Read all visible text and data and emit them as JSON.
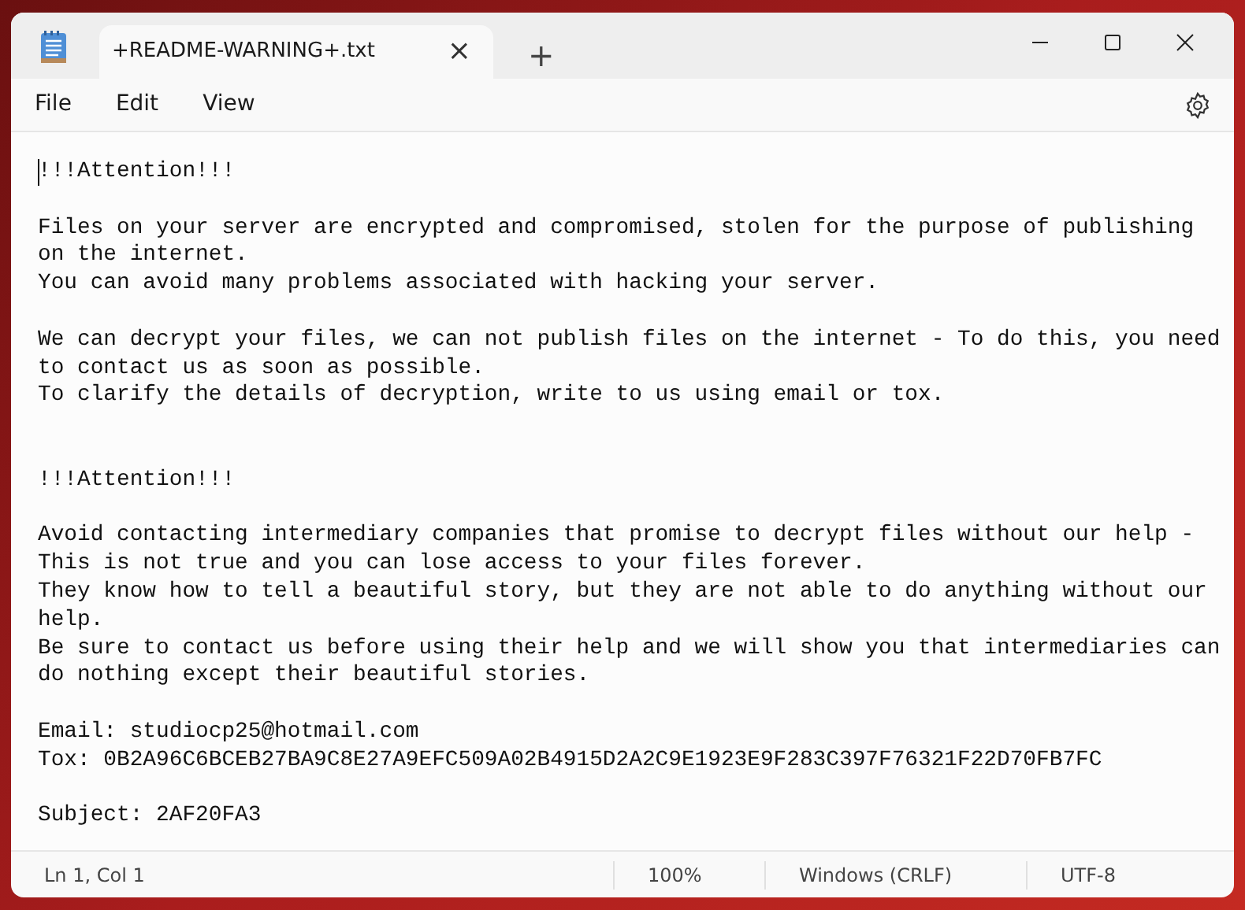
{
  "window": {
    "tabs": [
      {
        "title": "+README-WARNING+.txt",
        "selected": true,
        "close": "×"
      }
    ],
    "new_tab": "+"
  },
  "menu": [
    "File",
    "Edit",
    "View"
  ],
  "document": {
    "cursor_at_start": true,
    "lines": [
      {
        "kind": "text",
        "text": "!!!Attention!!!"
      },
      {
        "kind": "blank"
      },
      {
        "kind": "text",
        "text": "Files on your server are encrypted and compromised, stolen for the purpose of publishing"
      },
      {
        "kind": "text",
        "text": "on the internet."
      },
      {
        "kind": "text",
        "text": "You can avoid many problems associated with hacking your server."
      },
      {
        "kind": "blank"
      },
      {
        "kind": "text",
        "text": "We can decrypt your files, we can not publish files on the internet - To do this, you need"
      },
      {
        "kind": "text",
        "text": "to contact us as soon as possible."
      },
      {
        "kind": "text",
        "text": "To clarify the details of decryption, write to us using email or tox."
      },
      {
        "kind": "blank"
      },
      {
        "kind": "blank"
      },
      {
        "kind": "text",
        "text": "!!!Attention!!!"
      },
      {
        "kind": "blank"
      },
      {
        "kind": "text",
        "text": "Avoid contacting intermediary companies that promise to decrypt files without our help -"
      },
      {
        "kind": "text",
        "text": "This is not true and you can lose access to your files forever."
      },
      {
        "kind": "text",
        "text": "They know how to tell a beautiful story, but they are not able to do anything without our"
      },
      {
        "kind": "text",
        "text": "help."
      },
      {
        "kind": "text",
        "text": "Be sure to contact us before using their help and we will show you that intermediaries can"
      },
      {
        "kind": "text",
        "text": "do nothing except their beautiful stories."
      },
      {
        "kind": "blank"
      },
      {
        "kind": "text",
        "text": "Email: studiocp25@hotmail.com"
      },
      {
        "kind": "text",
        "text": "Tox: 0B2A96C6BCEB27BA9C8E27A9EFC509A02B4915D2A2C9E1923E9F283C397F76321F22D70FB7FC"
      },
      {
        "kind": "blank"
      },
      {
        "kind": "text",
        "text": "Subject: 2AF20FA3"
      }
    ]
  },
  "status_bar": {
    "position": "Ln 1, Col 1",
    "zoom": "100%",
    "line_ending": "Windows (CRLF)",
    "encoding": "UTF-8"
  }
}
